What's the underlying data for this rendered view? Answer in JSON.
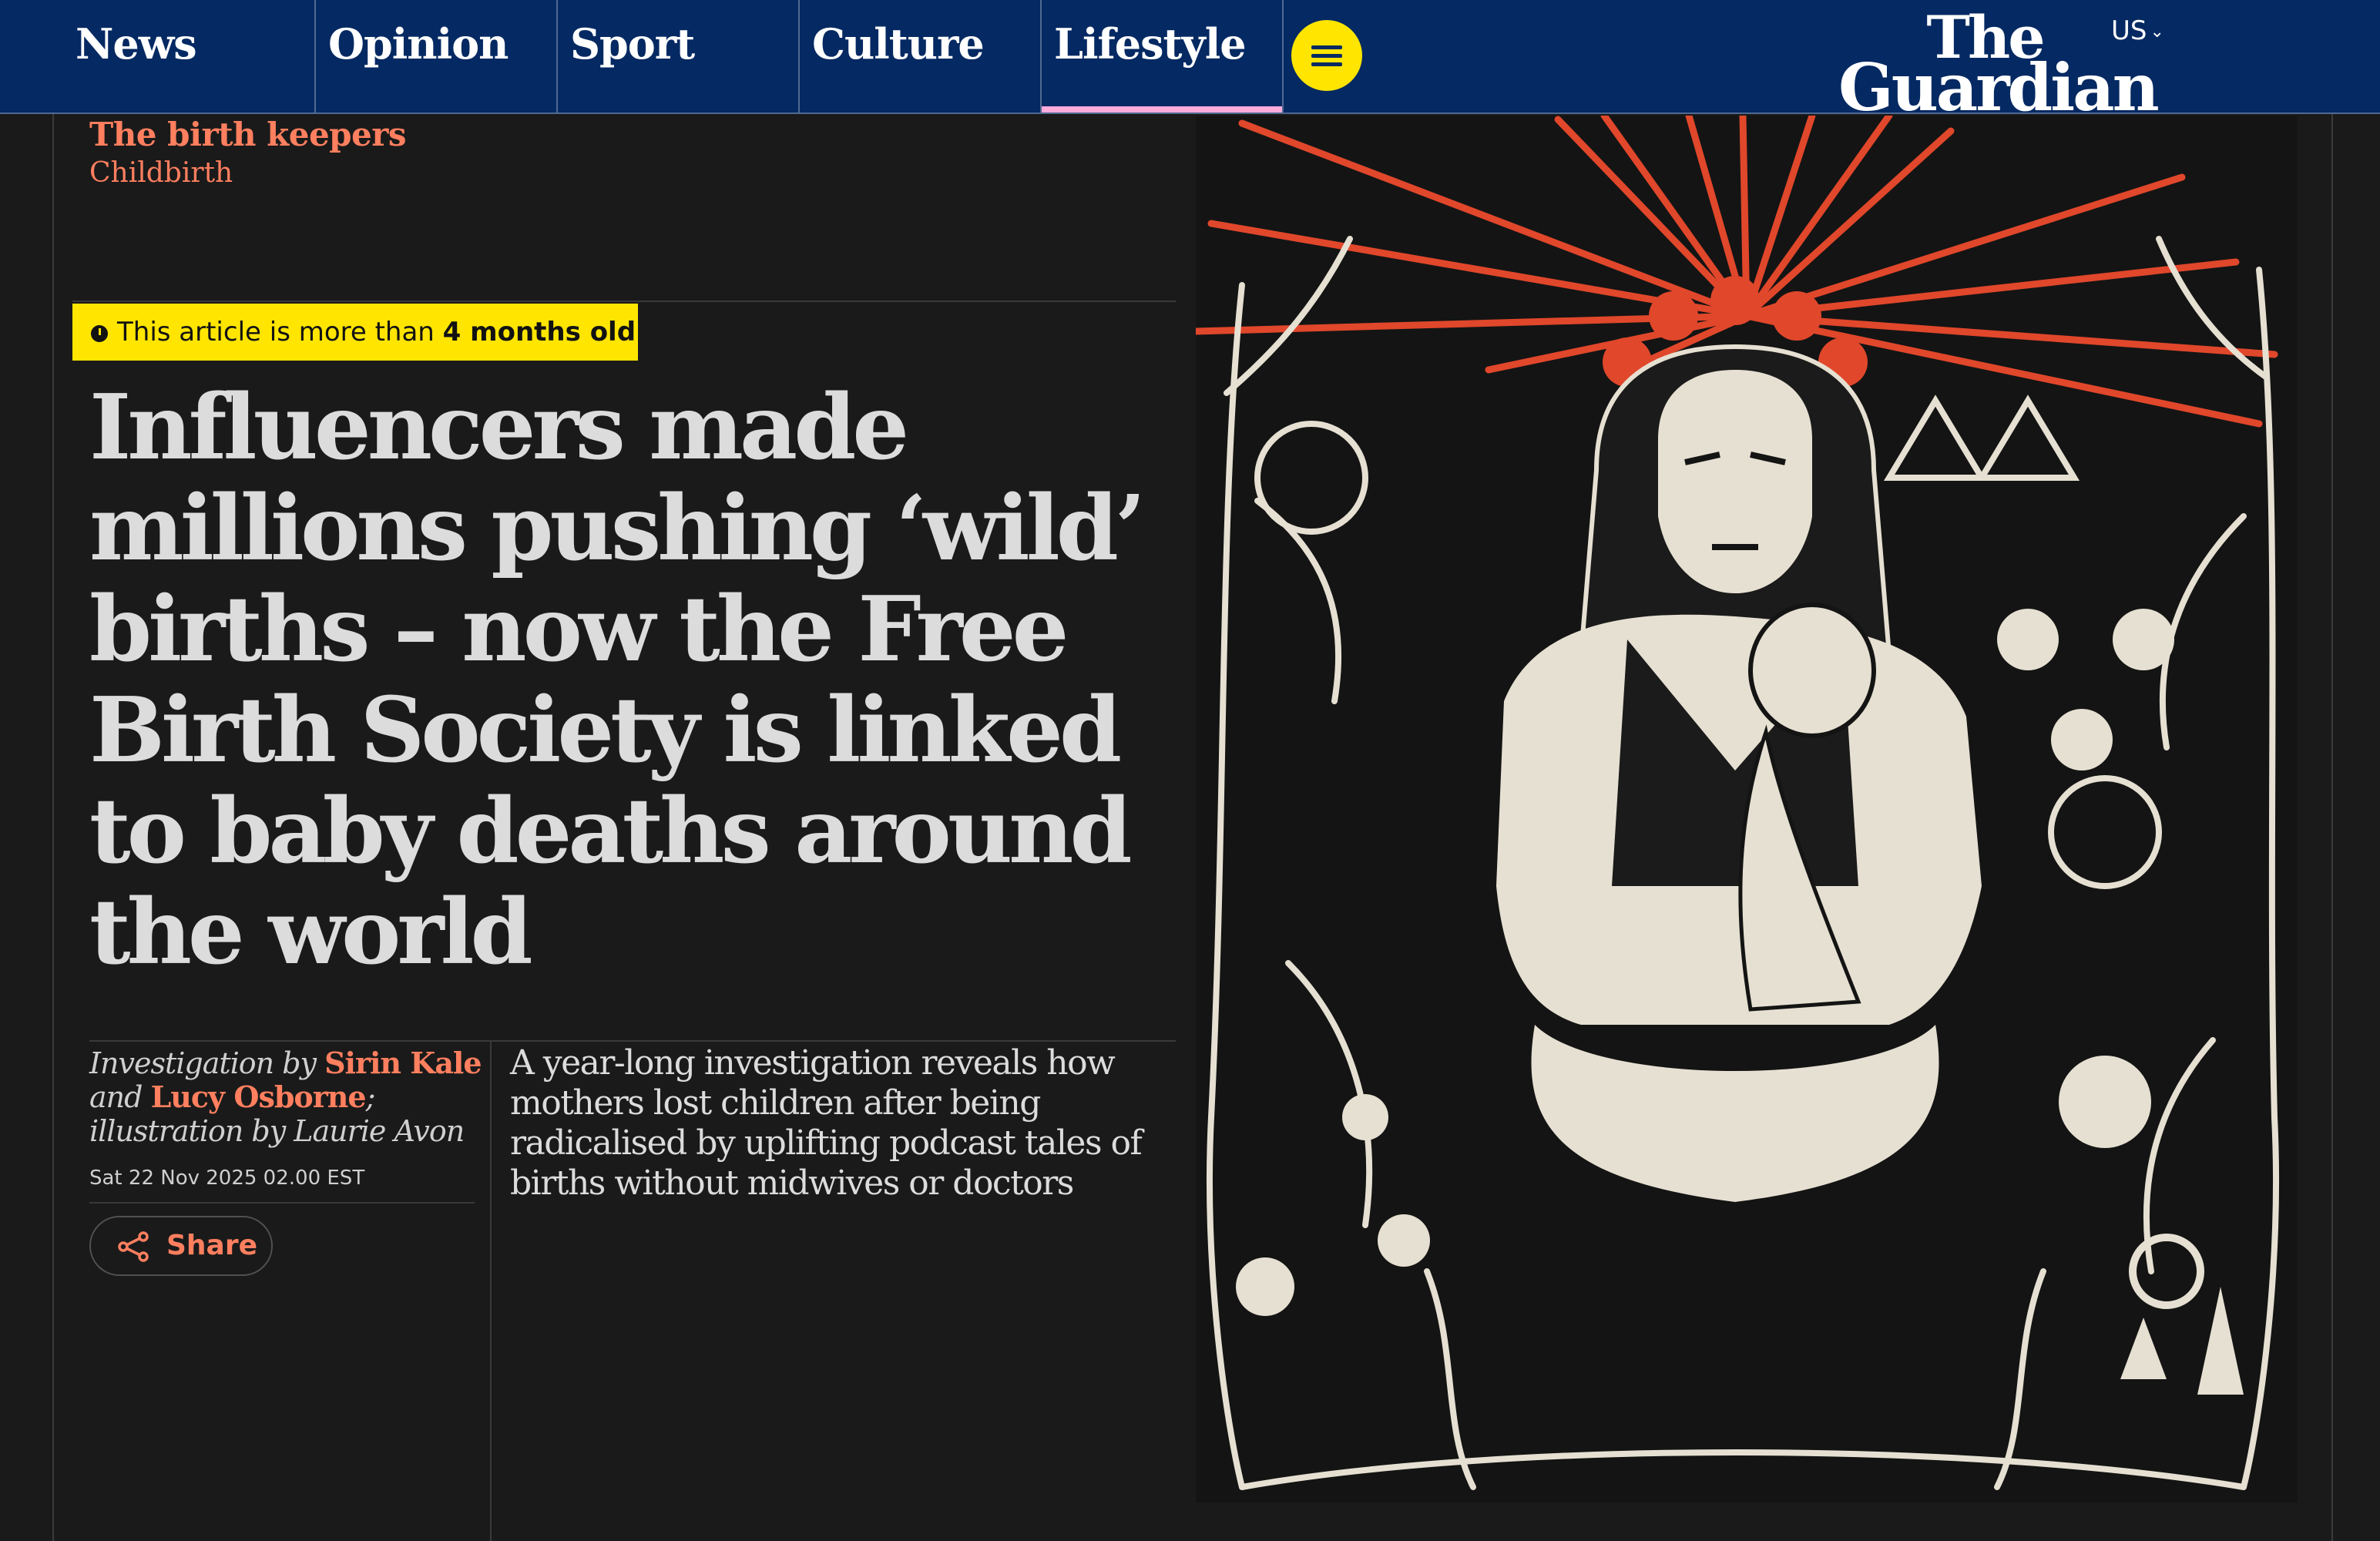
{
  "nav": {
    "items": [
      {
        "label": "News",
        "underline": "#c70000",
        "active": false
      },
      {
        "label": "Opinion",
        "underline": "#e05e00",
        "active": false
      },
      {
        "label": "Sport",
        "underline": "#0077b6",
        "active": false
      },
      {
        "label": "Culture",
        "underline": "#a1845c",
        "active": false
      },
      {
        "label": "Lifestyle",
        "underline": "#ffabdb",
        "active": true
      }
    ],
    "menu_icon": "hamburger-icon",
    "logo_line1": "The",
    "logo_line2": "Guardian",
    "edition": "US"
  },
  "article": {
    "series": "The birth keepers",
    "section": "Childbirth",
    "age_warning": {
      "prefix": "This article is more than",
      "age": "4 months old",
      "icon": "clock-icon"
    },
    "headline": "Influencers made millions pushing ‘wild’ births – now the Free Birth Society is linked to baby deaths around the world",
    "byline": {
      "intro": "Investigation by",
      "author1": "Sirin Kale",
      "and": "and",
      "author2": "Lucy Osborne",
      "sep": ";",
      "illustration": "illustration by Laurie Avon"
    },
    "date": "Sat 22 Nov 2025 02.00 EST",
    "share_label": "Share",
    "share_icon": "share-icon",
    "standfirst": "A year-long investigation reveals how mothers lost children after being radicalised by uplifting podcast tales of births without midwives or doctors"
  },
  "colors": {
    "brand_blue": "#052962",
    "kicker": "#ff7f5f",
    "age_warning_bg": "#ffe500",
    "background": "#1a1a1a",
    "illustration_red": "#e0472b",
    "illustration_cream": "#e6e0d2"
  }
}
